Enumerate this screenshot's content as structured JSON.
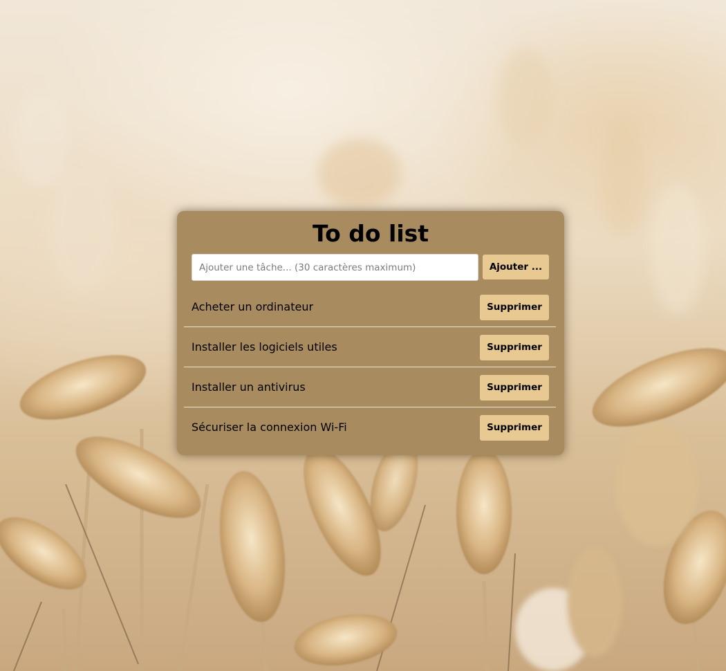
{
  "app": {
    "title": "To do list"
  },
  "input": {
    "value": "",
    "placeholder": "Ajouter une tâche... (30 caractères maximum)"
  },
  "add_button": {
    "label": "Ajouter ..."
  },
  "tasks": [
    {
      "text": "Acheter un ordinateur",
      "delete_label": "Supprimer"
    },
    {
      "text": "Installer les logiciels utiles",
      "delete_label": "Supprimer"
    },
    {
      "text": "Installer un antivirus",
      "delete_label": "Supprimer"
    },
    {
      "text": "Sécuriser la connexion Wi-Fi",
      "delete_label": "Supprimer"
    }
  ],
  "colors": {
    "card_background": "#a88b5f",
    "button_background": "#e8c991",
    "divider": "#e9e3d6",
    "text": "#000000"
  },
  "background": {
    "description_icon": "wheat-field-image"
  }
}
